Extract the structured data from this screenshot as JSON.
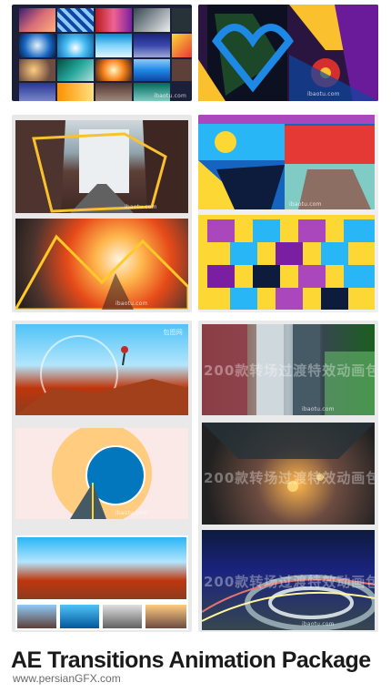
{
  "previews": [
    {
      "watermark": "ibaotu.com"
    },
    {
      "watermark": "ibaotu.com"
    },
    {
      "watermark": "ibaotu.com"
    },
    {
      "watermark": "ibaotu.com"
    },
    {
      "watermark": "ibaotu.com"
    },
    {
      "watermark": "ibaotu.com"
    },
    {
      "watermark": "ibaotu.com"
    },
    {
      "watermark": "ibaotu.com"
    }
  ],
  "overlay_text": "200款转场过渡特效动画包",
  "logo_mark": "包图网",
  "title": "AE Transitions Animation Package",
  "website": "www.persianGFX.com"
}
